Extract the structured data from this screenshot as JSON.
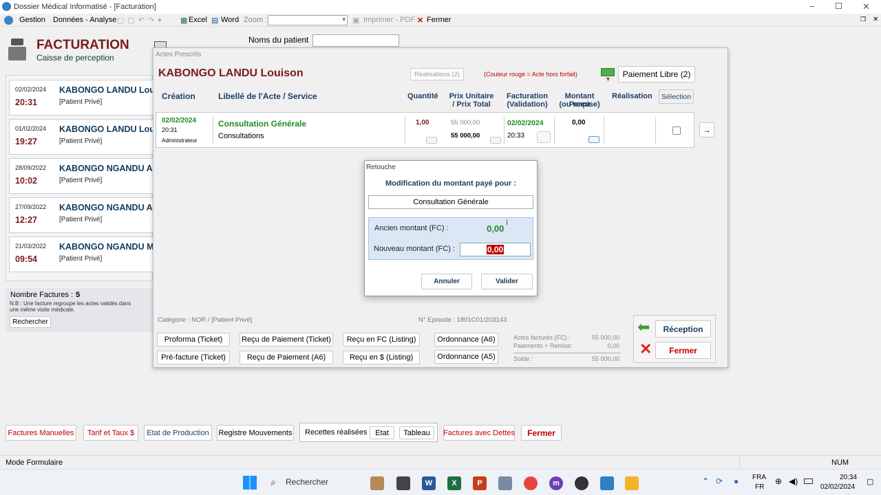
{
  "window": {
    "title": "Dossier Médical Informatisé - [Facturation]"
  },
  "menu": {
    "gestion": "Gestion",
    "donnees": "Données - Analyse",
    "excel": "Excel",
    "word": "Word",
    "zoom": "Zoom :",
    "imprimer": "Imprimer - PDF",
    "fermer": "Fermer"
  },
  "header": {
    "title": "FACTURATION",
    "subtitle": "Caisse de perception",
    "noms_label": "Noms du patient"
  },
  "invoices": [
    {
      "date": "02/02/2024",
      "time": "20:31",
      "name": "KABONGO LANDU Louison",
      "type": "[Patient Privé]"
    },
    {
      "date": "01/02/2024",
      "time": "19:27",
      "name": "KABONGO LANDU Louison",
      "type": "[Patient Privé]"
    },
    {
      "date": "28/09/2022",
      "time": "10:02",
      "name": "KABONGO NGANDU Alain",
      "type": "[Patient Privé]"
    },
    {
      "date": "27/09/2022",
      "time": "12:27",
      "name": "KABONGO NGANDU Alain",
      "type": "[Patient Privé]"
    },
    {
      "date": "21/03/2022",
      "time": "09:54",
      "name": "KABONGO NGANDU Michel",
      "type": "[Patient Privé]"
    }
  ],
  "left_footer": {
    "count_label": "Nombre Factures :",
    "count": "5",
    "note": "N.B : Une facture regroupe les actes validés dans une même visite médicale.",
    "search": "Rechercher"
  },
  "actes": {
    "window_title": "Actes Prescrits",
    "patient": "KABONGO LANDU Louison",
    "realisations": "Réalisations (2)",
    "legend": "(Couleur rouge = Acte hors forfait)",
    "paiement_libre": "Paiement Libre (2)",
    "columns": {
      "creation": "Création",
      "libelle": "Libellé de l'Acte / Service",
      "quantite": "Quantité",
      "prix1": "Prix Unitaire",
      "prix2": "/ Prix Total",
      "fact1": "Facturation",
      "fact2": "(Validation)",
      "mont1": "Montant Perçu",
      "mont2": "(ou remise)",
      "realisation": "Réalisation",
      "selection": "Sélection"
    },
    "row": {
      "date": "02/02/2024",
      "time": "20:31",
      "user": "Administrateur",
      "acte": "Consultation Générale",
      "categorie": "Consultations",
      "quantite": "1,00",
      "prix_unitaire": "55 000,00",
      "prix_total": "55 000,00",
      "fact_date": "02/02/2024",
      "fact_time": "20:33",
      "montant": "0,00"
    },
    "categorie_info": "Catégorie : NOR / [Patient Privé]",
    "episode": "N° Episode : 1801C01/203143",
    "buttons": {
      "proforma": "Proforma (Ticket)",
      "prefacture": "Pré-facture (Ticket)",
      "recu_ticket": "Reçu de Paiement (Ticket)",
      "recu_a6": "Reçu de Paiement (A6)",
      "recu_fc": "Reçu en FC (Listing)",
      "recu_usd": "Reçu en $ (Listing)",
      "ord_a6": "Ordonnance (A6)",
      "ord_a5": "Ordonnance (A5)",
      "reception": "Réception",
      "fermer": "Fermer"
    },
    "totals": {
      "factures_label": "Actes facturés (FC) :",
      "factures": "55 000,00",
      "paiements_label": "Paiements + Remise:",
      "paiements": "0,00",
      "solde_label": "Solde :",
      "solde": "55 000,00"
    }
  },
  "retouche": {
    "title": "Retouche",
    "heading": "Modification du montant payé pour :",
    "acte": "Consultation Générale",
    "ancien_label": "Ancien montant (FC) :",
    "ancien": "0,00",
    "nouveau_label": "Nouveau montant (FC) :",
    "nouveau": "0,00",
    "annuler": "Annuler",
    "valider": "Valider"
  },
  "bottom": {
    "manuelles": "Factures Manuelles",
    "tarif": "Tarif et Taux $",
    "production": "Etat de Production",
    "registre": "Registre Mouvements",
    "recettes": "Recettes réalisées :",
    "etat": "Etat",
    "tableau": "Tableau",
    "dettes": "Factures avec Dettes",
    "fermer": "Fermer"
  },
  "status": {
    "mode": "Mode Formulaire",
    "num": "NUM"
  },
  "taskbar": {
    "search": "Rechercher",
    "lang1": "FRA",
    "lang2": "FR",
    "time": "20:34",
    "date": "02/02/2024"
  },
  "colors": {
    "navy": "#1f3d63",
    "maroon": "#7b1a1a",
    "green": "#1f8a1f",
    "red": "#c00000"
  }
}
